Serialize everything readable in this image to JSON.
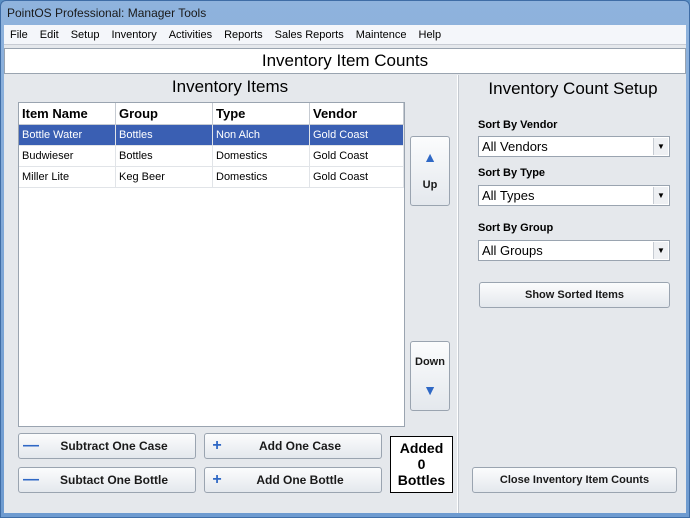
{
  "window": {
    "title": "PointOS Professional: Manager Tools"
  },
  "menu": [
    "File",
    "Edit",
    "Setup",
    "Inventory",
    "Activities",
    "Reports",
    "Sales Reports",
    "Maintence",
    "Help"
  ],
  "header": {
    "title": "Inventory Item Counts"
  },
  "inventory": {
    "title": "Inventory Items",
    "columns": [
      "Item Name",
      "Group",
      "Type",
      "Vendor"
    ],
    "rows": [
      [
        "Bottle Water",
        "Bottles",
        "Non Alch",
        "Gold Coast"
      ],
      [
        "Budwieser",
        "Bottles",
        "Domestics",
        "Gold Coast"
      ],
      [
        "Miller Lite",
        "Keg Beer",
        "Domestics",
        "Gold Coast"
      ]
    ],
    "selected_row": 0
  },
  "move": {
    "up_label": "Up",
    "down_label": "Down"
  },
  "actions": {
    "subtract_case": "Subtract One Case",
    "add_case": "Add One Case",
    "subtract_bottle": "Subtact One Bottle",
    "add_bottle": "Add One Bottle"
  },
  "added": {
    "line1": "Added",
    "count": "0",
    "line3": "Bottles"
  },
  "setup": {
    "title": "Inventory Count Setup",
    "vendor_label": "Sort By Vendor",
    "vendor_value": "All Vendors",
    "type_label": "Sort By Type",
    "type_value": "All Types",
    "group_label": "Sort By Group",
    "group_value": "All Groups",
    "show_button": "Show Sorted Items",
    "close_button": "Close Inventory Item Counts"
  },
  "colors": {
    "selection": "#3a5fb3",
    "accent_icon": "#2f68c5"
  }
}
